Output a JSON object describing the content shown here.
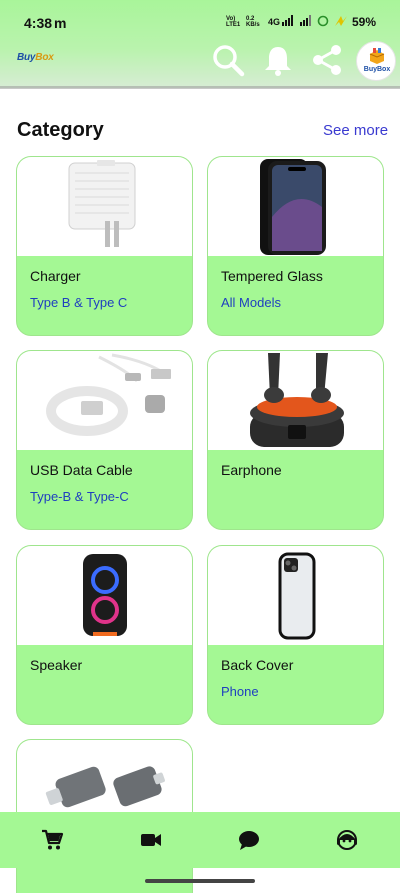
{
  "status_bar": {
    "time": "4:38",
    "m_icon_label": "m",
    "volte_top": "Vo)",
    "volte_bottom": "LTE1",
    "speed_top": "0.2",
    "speed_bottom": "KB/s",
    "network": "4G",
    "battery_percent": "59%"
  },
  "header": {
    "logo_text_a": "Buy",
    "logo_text_b": "Box",
    "avatar_label": "BuyBox",
    "icons": [
      "search-icon",
      "bell-icon",
      "share-icon",
      "profile-avatar"
    ]
  },
  "category": {
    "title": "Category",
    "see_more": "See more"
  },
  "cards": [
    {
      "name": "Charger",
      "sub": "Type B & Type C"
    },
    {
      "name": "Tempered Glass",
      "sub": "All Models"
    },
    {
      "name": "USB Data Cable",
      "sub": "Type-B & Type-C"
    },
    {
      "name": "Earphone",
      "sub": ""
    },
    {
      "name": "Speaker",
      "sub": ""
    },
    {
      "name": "Back Cover",
      "sub": "Phone"
    },
    {
      "name": "",
      "sub": ""
    }
  ],
  "bottom_nav": {
    "items": [
      "cart-icon",
      "video-camera-icon",
      "chat-icon",
      "support-agent-icon"
    ]
  },
  "colors": {
    "accent_green": "#a4f894",
    "link_blue": "#3a3ad0",
    "sub_blue": "#1f3fbf"
  }
}
